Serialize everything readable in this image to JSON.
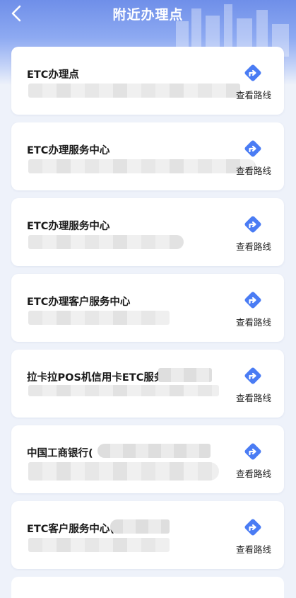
{
  "header": {
    "title": "附近办理点",
    "back_icon": "chevron-left-icon"
  },
  "colors": {
    "accent": "#4a7cf4",
    "header_top": "#6f8fe9",
    "background": "#eef2fa"
  },
  "cards": [
    {
      "name": "ETC办理点",
      "route_label": "查看路线",
      "route_icon": "directions-icon"
    },
    {
      "name": "ETC办理服务中心",
      "route_label": "查看路线",
      "route_icon": "directions-icon"
    },
    {
      "name": "ETC办理服务中心",
      "route_label": "查看路线",
      "route_icon": "directions-icon"
    },
    {
      "name": "ETC办理客户服务中心",
      "route_label": "查看路线",
      "route_icon": "directions-icon"
    },
    {
      "name": "拉卡拉POS机信用卡ETC服务",
      "route_label": "查看路线",
      "route_icon": "directions-icon"
    },
    {
      "name": "中国工商银行(",
      "route_label": "查看路线",
      "route_icon": "directions-icon"
    },
    {
      "name": "ETC客户服务中心(",
      "route_label": "查看路线",
      "route_icon": "directions-icon"
    }
  ]
}
